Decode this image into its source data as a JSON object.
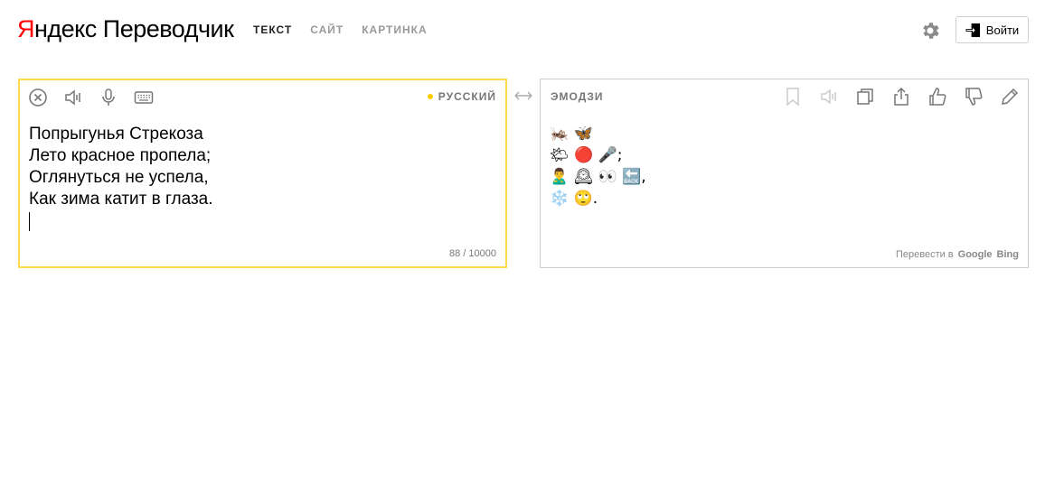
{
  "header": {
    "logo_brand_first": "Я",
    "logo_brand_rest": "ндекс",
    "logo_product": "Переводчик",
    "nav": [
      "ТЕКСТ",
      "САЙТ",
      "КАРТИНКА"
    ],
    "active_nav": "ТЕКСТ",
    "login_label": "Войти"
  },
  "source": {
    "language": "РУССКИЙ",
    "text": "Попрыгунья Стрекоза\nЛето красное пропела;\nОглянуться не успела,\nКак зима катит в глаза.",
    "counter": "88 / 10000",
    "tools": [
      "clear-icon",
      "speaker-icon",
      "microphone-icon",
      "keyboard-icon"
    ]
  },
  "target": {
    "language": "ЭМОДЗИ",
    "text": "🦗 🦋\n🌤 🔴 🎤;\n🙎‍♂️ 🕰 👀 🔙,\n❄️ 🙄.",
    "translate_via_label": "Перевести в",
    "services": [
      "Google",
      "Bing"
    ],
    "tools": [
      "bookmark-icon",
      "speaker-icon",
      "copy-icon",
      "share-icon",
      "thumbs-up-icon",
      "thumbs-down-icon",
      "edit-icon"
    ]
  },
  "colors": {
    "accent_yellow": "#ffdb4d",
    "brand_red": "#ff0000"
  }
}
